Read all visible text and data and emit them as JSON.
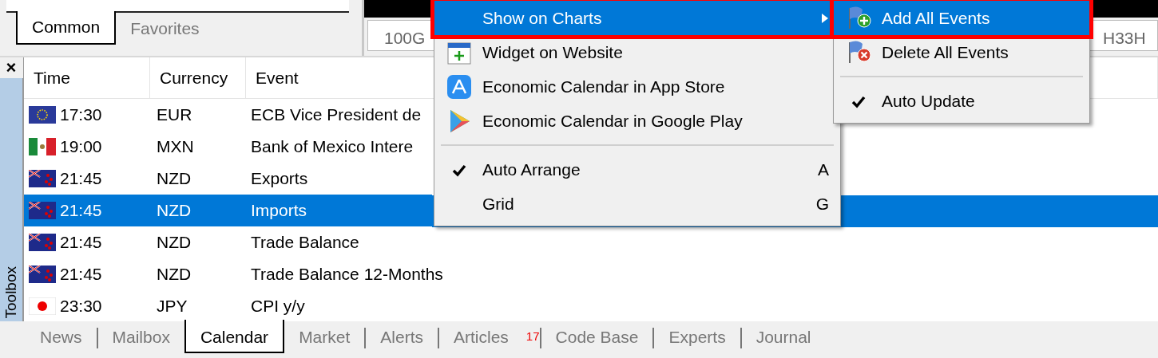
{
  "navigator": {
    "tabs": [
      {
        "label": "Common",
        "selected": true
      },
      {
        "label": "Favorites",
        "selected": false
      }
    ]
  },
  "chart_tabs": [
    {
      "label": "100G"
    },
    {
      "label": "H33H"
    }
  ],
  "toolbox": {
    "title": "Toolbox",
    "close": "×"
  },
  "table": {
    "columns": [
      "Time",
      "Currency",
      "Event"
    ],
    "rows": [
      {
        "kind": "eu",
        "time": "17:30",
        "currency": "EUR",
        "event": "ECB Vice President de",
        "selected": false
      },
      {
        "kind": "mx",
        "time": "19:00",
        "currency": "MXN",
        "event": "Bank of Mexico Intere",
        "selected": false
      },
      {
        "kind": "nz",
        "time": "21:45",
        "currency": "NZD",
        "event": "Exports",
        "selected": false
      },
      {
        "kind": "nz",
        "time": "21:45",
        "currency": "NZD",
        "event": "Imports",
        "selected": true
      },
      {
        "kind": "nz",
        "time": "21:45",
        "currency": "NZD",
        "event": "Trade Balance",
        "selected": false
      },
      {
        "kind": "nz",
        "time": "21:45",
        "currency": "NZD",
        "event": "Trade Balance 12-Months",
        "selected": false
      },
      {
        "kind": "jp",
        "time": "23:30",
        "currency": "JPY",
        "event": "CPI y/y",
        "selected": false
      }
    ]
  },
  "bottom_tabs": [
    {
      "label": "News",
      "selected": false
    },
    {
      "label": "Mailbox",
      "selected": false
    },
    {
      "label": "Calendar",
      "selected": true
    },
    {
      "label": "Market",
      "selected": false
    },
    {
      "label": "Alerts",
      "selected": false
    },
    {
      "label": "Articles",
      "badge": "17",
      "selected": false
    },
    {
      "label": "Code Base",
      "selected": false
    },
    {
      "label": "Experts",
      "selected": false
    },
    {
      "label": "Journal",
      "selected": false
    }
  ],
  "context_menu": [
    {
      "kind": "plain",
      "label": "Show on Charts",
      "submenu": true,
      "selected": true,
      "highlighted": true
    },
    {
      "kind": "widget",
      "label": "Widget on Website",
      "selected": false
    },
    {
      "kind": "appstore",
      "label": "Economic Calendar in App Store",
      "selected": false
    },
    {
      "kind": "play",
      "label": "Economic Calendar in Google Play",
      "selected": false
    },
    {
      "kind": "separator"
    },
    {
      "kind": "plain",
      "label": "Auto Arrange",
      "checked": true,
      "shortcut": "A",
      "selected": false
    },
    {
      "kind": "plain",
      "label": "Grid",
      "checked": false,
      "shortcut": "G",
      "selected": false
    }
  ],
  "submenu": [
    {
      "kind": "flagadd",
      "label": "Add All Events",
      "selected": true,
      "highlighted": true
    },
    {
      "kind": "flagdelete",
      "label": "Delete All Events",
      "selected": false
    },
    {
      "kind": "separator"
    },
    {
      "kind": "plain",
      "label": "Auto Update",
      "checked": true,
      "selected": false
    }
  ]
}
